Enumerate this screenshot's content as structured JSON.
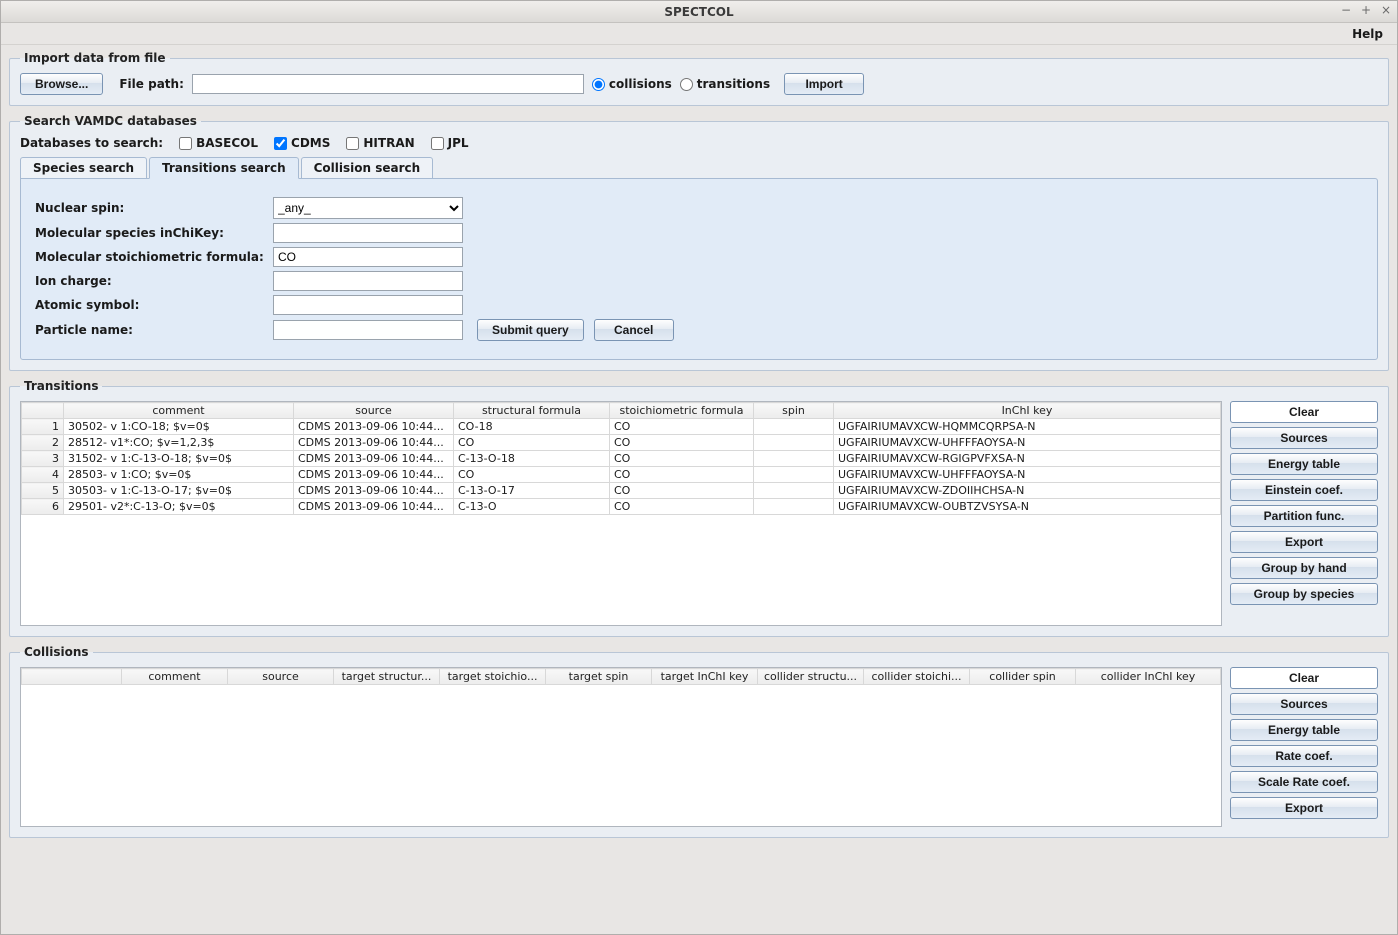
{
  "window": {
    "title": "SPECTCOL"
  },
  "menubar": {
    "help": "Help"
  },
  "import": {
    "legend": "Import data from file",
    "browse": "Browse...",
    "filepath_label": "File path:",
    "filepath_value": "",
    "radio_collisions": "collisions",
    "radio_transitions": "transitions",
    "import_btn": "Import"
  },
  "search": {
    "legend": "Search VAMDC databases",
    "db_label": "Databases to search:",
    "db": {
      "basecol": "BASECOL",
      "cdms": "CDMS",
      "hitran": "HITRAN",
      "jpl": "JPL"
    },
    "tabs": {
      "species": "Species search",
      "transitions": "Transitions search",
      "collision": "Collision search"
    },
    "form": {
      "nuclear_spin": {
        "label": "Nuclear spin:",
        "value": "_any_"
      },
      "inchikey": {
        "label": "Molecular species inChiKey:",
        "value": ""
      },
      "stoichiometric": {
        "label": "Molecular stoichiometric formula:",
        "value": "CO"
      },
      "ion_charge": {
        "label": "Ion charge:",
        "value": ""
      },
      "atomic_symbol": {
        "label": "Atomic symbol:",
        "value": ""
      },
      "particle_name": {
        "label": "Particle name:",
        "value": ""
      },
      "submit": "Submit query",
      "cancel": "Cancel"
    }
  },
  "transitions": {
    "legend": "Transitions",
    "headers": [
      "comment",
      "source",
      "structural formula",
      "stoichiometric formula",
      "spin",
      "InChI key"
    ],
    "rows": [
      {
        "n": "1",
        "comment": "30502- v 1:CO-18; $v=0$",
        "source": "CDMS 2013-09-06 10:44...",
        "structural": "CO-18",
        "stoich": "CO",
        "spin": "",
        "inchi": "UGFAIRIUMAVXCW-HQMMCQRPSA-N"
      },
      {
        "n": "2",
        "comment": "28512- v1*:CO; $v=1,2,3$",
        "source": "CDMS 2013-09-06 10:44...",
        "structural": "CO",
        "stoich": "CO",
        "spin": "",
        "inchi": "UGFAIRIUMAVXCW-UHFFFAOYSA-N"
      },
      {
        "n": "3",
        "comment": "31502- v 1:C-13-O-18; $v=0$",
        "source": "CDMS 2013-09-06 10:44...",
        "structural": "C-13-O-18",
        "stoich": "CO",
        "spin": "",
        "inchi": "UGFAIRIUMAVXCW-RGIGPVFXSA-N"
      },
      {
        "n": "4",
        "comment": "28503- v 1:CO; $v=0$",
        "source": "CDMS 2013-09-06 10:44...",
        "structural": "CO",
        "stoich": "CO",
        "spin": "",
        "inchi": "UGFAIRIUMAVXCW-UHFFFAOYSA-N"
      },
      {
        "n": "5",
        "comment": "30503- v 1:C-13-O-17; $v=0$",
        "source": "CDMS 2013-09-06 10:44...",
        "structural": "C-13-O-17",
        "stoich": "CO",
        "spin": "",
        "inchi": "UGFAIRIUMAVXCW-ZDOIIHCHSA-N"
      },
      {
        "n": "6",
        "comment": "29501- v2*:C-13-O; $v=0$",
        "source": "CDMS 2013-09-06 10:44...",
        "structural": "C-13-O",
        "stoich": "CO",
        "spin": "",
        "inchi": "UGFAIRIUMAVXCW-OUBTZVSYSA-N"
      }
    ],
    "buttons": {
      "clear": "Clear",
      "sources": "Sources",
      "energy": "Energy table",
      "einstein": "Einstein coef.",
      "partition": "Partition func.",
      "export": "Export",
      "group_hand": "Group by hand",
      "group_species": "Group by species"
    }
  },
  "collisions": {
    "legend": "Collisions",
    "headers": [
      "comment",
      "source",
      "target structur...",
      "target stoichio...",
      "target spin",
      "target InChI key",
      "collider structu...",
      "collider stoichi...",
      "collider spin",
      "collider InChI key"
    ],
    "buttons": {
      "clear": "Clear",
      "sources": "Sources",
      "energy": "Energy table",
      "rate": "Rate coef.",
      "scale_rate": "Scale Rate coef.",
      "export": "Export"
    }
  }
}
